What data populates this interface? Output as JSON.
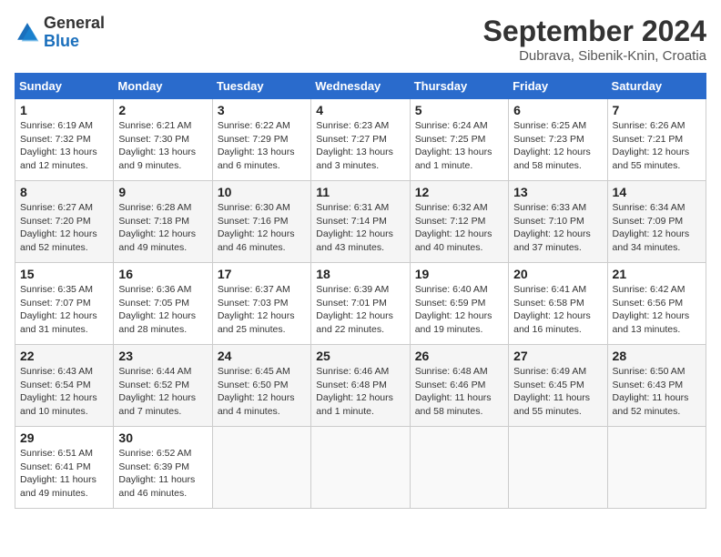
{
  "header": {
    "logo_general": "General",
    "logo_blue": "Blue",
    "month_title": "September 2024",
    "location": "Dubrava, Sibenik-Knin, Croatia"
  },
  "columns": [
    "Sunday",
    "Monday",
    "Tuesday",
    "Wednesday",
    "Thursday",
    "Friday",
    "Saturday"
  ],
  "weeks": [
    [
      {
        "day": "1",
        "info": "Sunrise: 6:19 AM\nSunset: 7:32 PM\nDaylight: 13 hours\nand 12 minutes."
      },
      {
        "day": "2",
        "info": "Sunrise: 6:21 AM\nSunset: 7:30 PM\nDaylight: 13 hours\nand 9 minutes."
      },
      {
        "day": "3",
        "info": "Sunrise: 6:22 AM\nSunset: 7:29 PM\nDaylight: 13 hours\nand 6 minutes."
      },
      {
        "day": "4",
        "info": "Sunrise: 6:23 AM\nSunset: 7:27 PM\nDaylight: 13 hours\nand 3 minutes."
      },
      {
        "day": "5",
        "info": "Sunrise: 6:24 AM\nSunset: 7:25 PM\nDaylight: 13 hours\nand 1 minute."
      },
      {
        "day": "6",
        "info": "Sunrise: 6:25 AM\nSunset: 7:23 PM\nDaylight: 12 hours\nand 58 minutes."
      },
      {
        "day": "7",
        "info": "Sunrise: 6:26 AM\nSunset: 7:21 PM\nDaylight: 12 hours\nand 55 minutes."
      }
    ],
    [
      {
        "day": "8",
        "info": "Sunrise: 6:27 AM\nSunset: 7:20 PM\nDaylight: 12 hours\nand 52 minutes."
      },
      {
        "day": "9",
        "info": "Sunrise: 6:28 AM\nSunset: 7:18 PM\nDaylight: 12 hours\nand 49 minutes."
      },
      {
        "day": "10",
        "info": "Sunrise: 6:30 AM\nSunset: 7:16 PM\nDaylight: 12 hours\nand 46 minutes."
      },
      {
        "day": "11",
        "info": "Sunrise: 6:31 AM\nSunset: 7:14 PM\nDaylight: 12 hours\nand 43 minutes."
      },
      {
        "day": "12",
        "info": "Sunrise: 6:32 AM\nSunset: 7:12 PM\nDaylight: 12 hours\nand 40 minutes."
      },
      {
        "day": "13",
        "info": "Sunrise: 6:33 AM\nSunset: 7:10 PM\nDaylight: 12 hours\nand 37 minutes."
      },
      {
        "day": "14",
        "info": "Sunrise: 6:34 AM\nSunset: 7:09 PM\nDaylight: 12 hours\nand 34 minutes."
      }
    ],
    [
      {
        "day": "15",
        "info": "Sunrise: 6:35 AM\nSunset: 7:07 PM\nDaylight: 12 hours\nand 31 minutes."
      },
      {
        "day": "16",
        "info": "Sunrise: 6:36 AM\nSunset: 7:05 PM\nDaylight: 12 hours\nand 28 minutes."
      },
      {
        "day": "17",
        "info": "Sunrise: 6:37 AM\nSunset: 7:03 PM\nDaylight: 12 hours\nand 25 minutes."
      },
      {
        "day": "18",
        "info": "Sunrise: 6:39 AM\nSunset: 7:01 PM\nDaylight: 12 hours\nand 22 minutes."
      },
      {
        "day": "19",
        "info": "Sunrise: 6:40 AM\nSunset: 6:59 PM\nDaylight: 12 hours\nand 19 minutes."
      },
      {
        "day": "20",
        "info": "Sunrise: 6:41 AM\nSunset: 6:58 PM\nDaylight: 12 hours\nand 16 minutes."
      },
      {
        "day": "21",
        "info": "Sunrise: 6:42 AM\nSunset: 6:56 PM\nDaylight: 12 hours\nand 13 minutes."
      }
    ],
    [
      {
        "day": "22",
        "info": "Sunrise: 6:43 AM\nSunset: 6:54 PM\nDaylight: 12 hours\nand 10 minutes."
      },
      {
        "day": "23",
        "info": "Sunrise: 6:44 AM\nSunset: 6:52 PM\nDaylight: 12 hours\nand 7 minutes."
      },
      {
        "day": "24",
        "info": "Sunrise: 6:45 AM\nSunset: 6:50 PM\nDaylight: 12 hours\nand 4 minutes."
      },
      {
        "day": "25",
        "info": "Sunrise: 6:46 AM\nSunset: 6:48 PM\nDaylight: 12 hours\nand 1 minute."
      },
      {
        "day": "26",
        "info": "Sunrise: 6:48 AM\nSunset: 6:46 PM\nDaylight: 11 hours\nand 58 minutes."
      },
      {
        "day": "27",
        "info": "Sunrise: 6:49 AM\nSunset: 6:45 PM\nDaylight: 11 hours\nand 55 minutes."
      },
      {
        "day": "28",
        "info": "Sunrise: 6:50 AM\nSunset: 6:43 PM\nDaylight: 11 hours\nand 52 minutes."
      }
    ],
    [
      {
        "day": "29",
        "info": "Sunrise: 6:51 AM\nSunset: 6:41 PM\nDaylight: 11 hours\nand 49 minutes."
      },
      {
        "day": "30",
        "info": "Sunrise: 6:52 AM\nSunset: 6:39 PM\nDaylight: 11 hours\nand 46 minutes."
      },
      null,
      null,
      null,
      null,
      null
    ]
  ]
}
